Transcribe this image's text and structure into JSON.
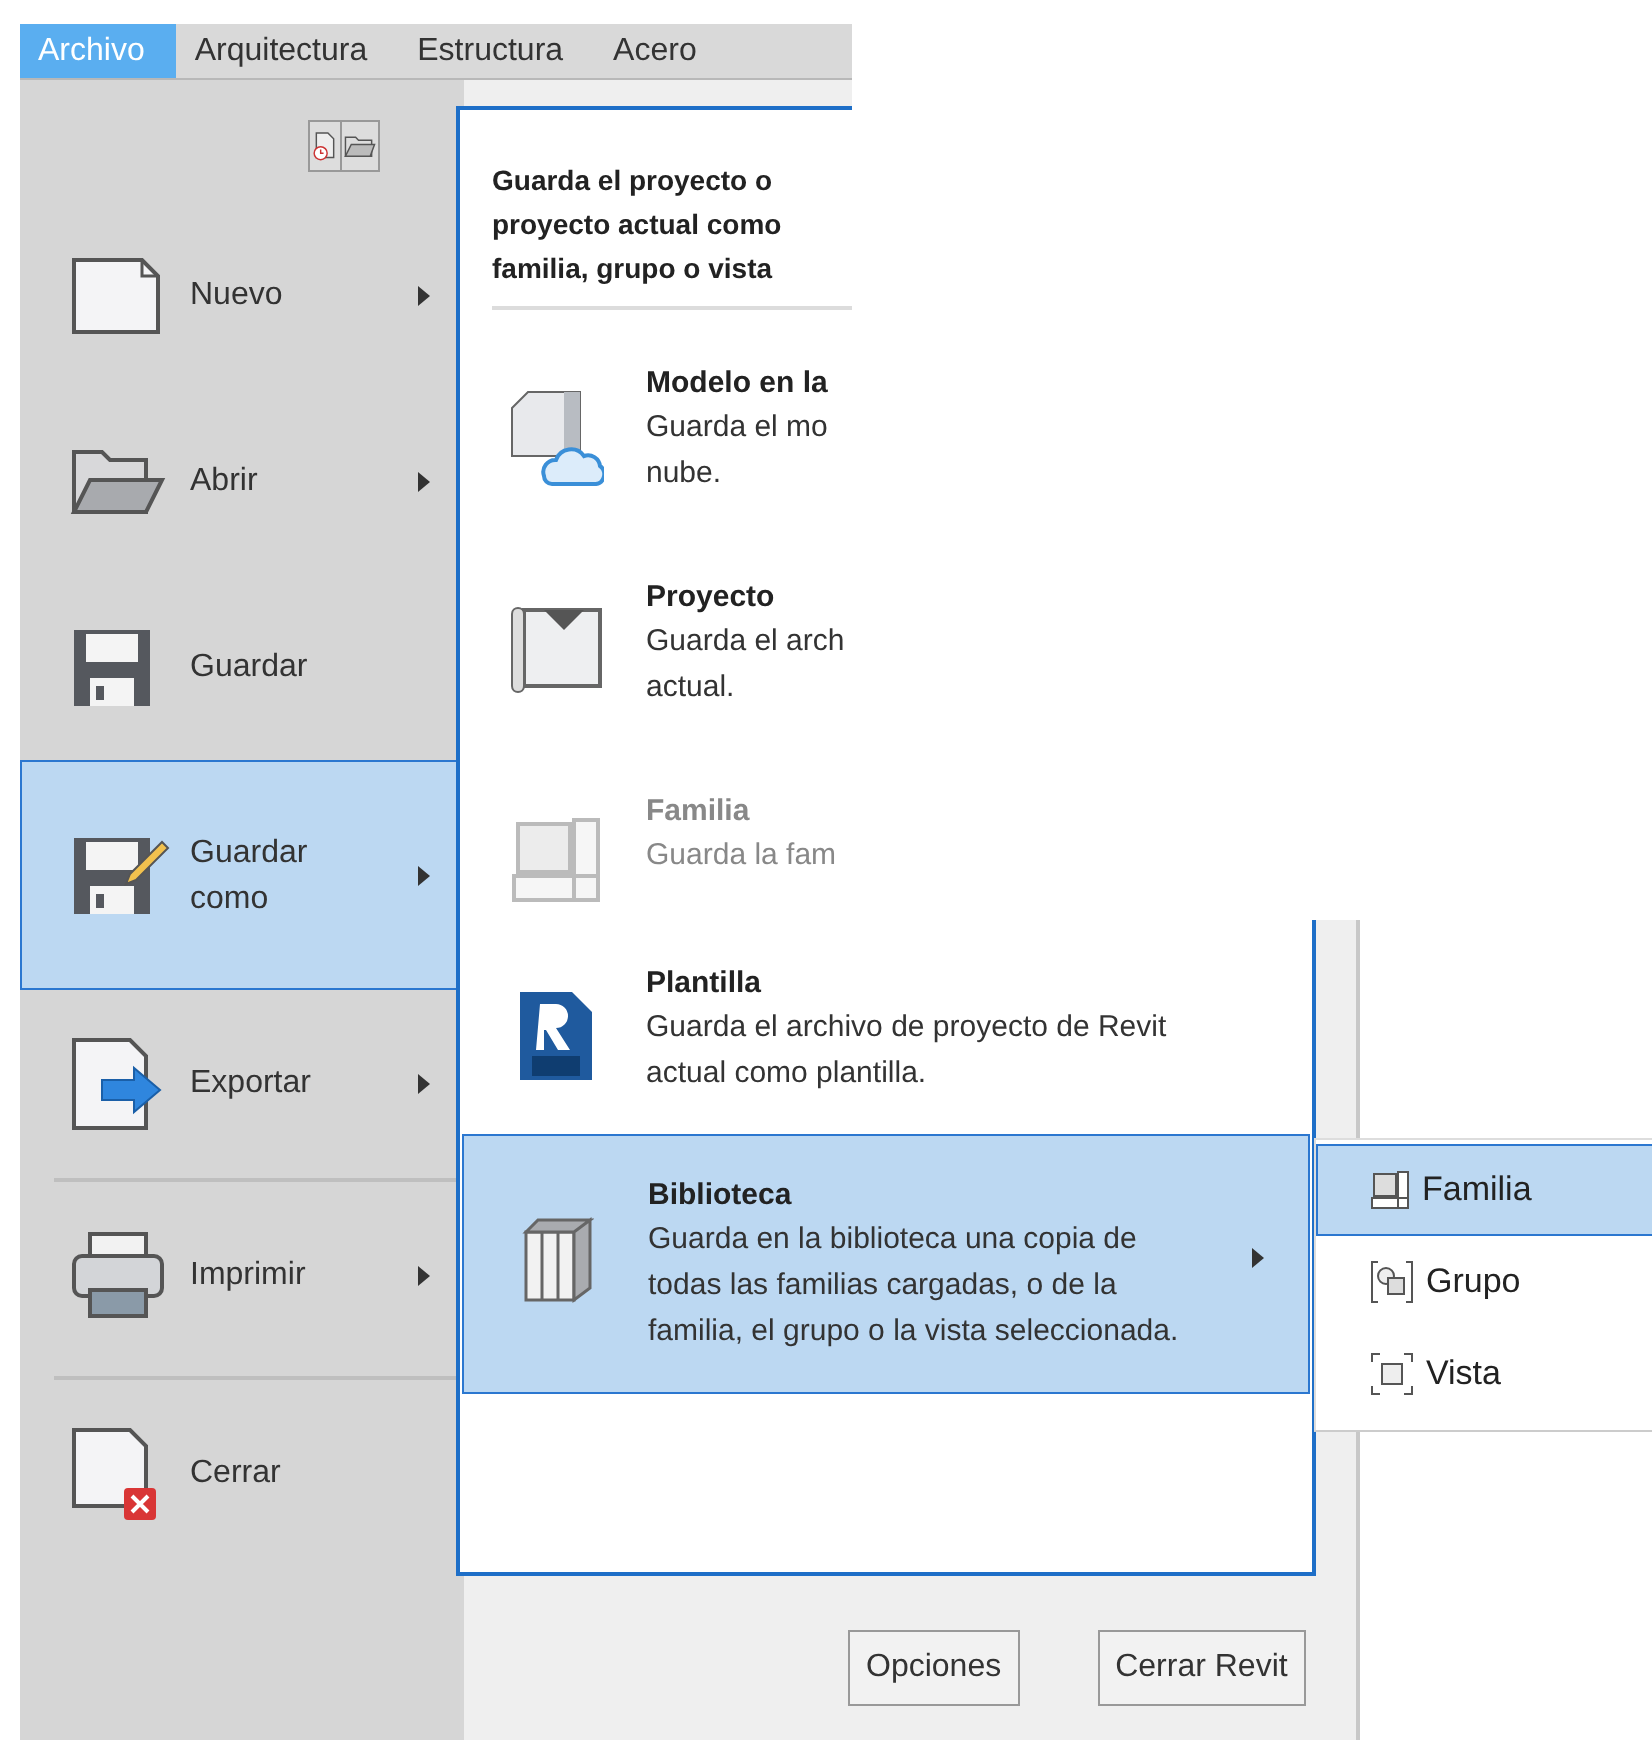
{
  "menu_tabs": [
    {
      "label": "Archivo",
      "selected": true
    },
    {
      "label": "Arquitectura",
      "selected": false
    },
    {
      "label": "Estructura",
      "selected": false
    },
    {
      "label": "Acero",
      "selected": false
    }
  ],
  "left_menu": [
    {
      "label": "Nuevo",
      "kind": "new",
      "has_submenu": true,
      "selected": false,
      "divider_above": false
    },
    {
      "label": "Abrir",
      "kind": "open",
      "has_submenu": true,
      "selected": false,
      "divider_above": false
    },
    {
      "label": "Guardar",
      "kind": "save",
      "has_submenu": false,
      "selected": false,
      "divider_above": false
    },
    {
      "label": "Guardar como",
      "kind": "saveas",
      "has_submenu": true,
      "selected": true,
      "divider_above": false
    },
    {
      "label": "Exportar",
      "kind": "export",
      "has_submenu": true,
      "selected": false,
      "divider_above": false
    },
    {
      "label": "Imprimir",
      "kind": "print",
      "has_submenu": true,
      "selected": false,
      "divider_above": true
    },
    {
      "label": "Cerrar",
      "kind": "close",
      "has_submenu": false,
      "selected": false,
      "divider_above": true
    }
  ],
  "panel": {
    "header": [
      "Guarda el proyecto o",
      "proyecto actual como",
      "familia, grupo o vista"
    ],
    "items": [
      {
        "title": "Modelo en la",
        "lines": [
          "Guarda el mo",
          "nube."
        ],
        "kind": "cloud",
        "disabled": false,
        "selected": false,
        "has_submenu": false
      },
      {
        "title": "Proyecto",
        "lines": [
          "Guarda el arch",
          "actual."
        ],
        "kind": "project",
        "disabled": false,
        "selected": false,
        "has_submenu": false
      },
      {
        "title": "Familia",
        "lines": [
          "Guarda la fam"
        ],
        "kind": "family",
        "disabled": true,
        "selected": false,
        "has_submenu": false
      },
      {
        "title": "Plantilla",
        "lines": [
          "Guarda el archivo de proyecto de Revit",
          "actual como plantilla."
        ],
        "kind": "template",
        "disabled": false,
        "selected": false,
        "has_submenu": false
      },
      {
        "title": "Biblioteca",
        "lines": [
          "Guarda en la biblioteca una copia de",
          "todas las familias cargadas, o de la",
          "familia, el grupo o la vista seleccionada."
        ],
        "kind": "library",
        "disabled": false,
        "selected": true,
        "has_submenu": true
      }
    ]
  },
  "submenu": [
    {
      "label": "Familia",
      "kind": "family",
      "selected": true
    },
    {
      "label": "Grupo",
      "kind": "group",
      "selected": false
    },
    {
      "label": "Vista",
      "kind": "view",
      "selected": false
    }
  ],
  "buttons": [
    "Opciones",
    "Cerrar Revit"
  ]
}
